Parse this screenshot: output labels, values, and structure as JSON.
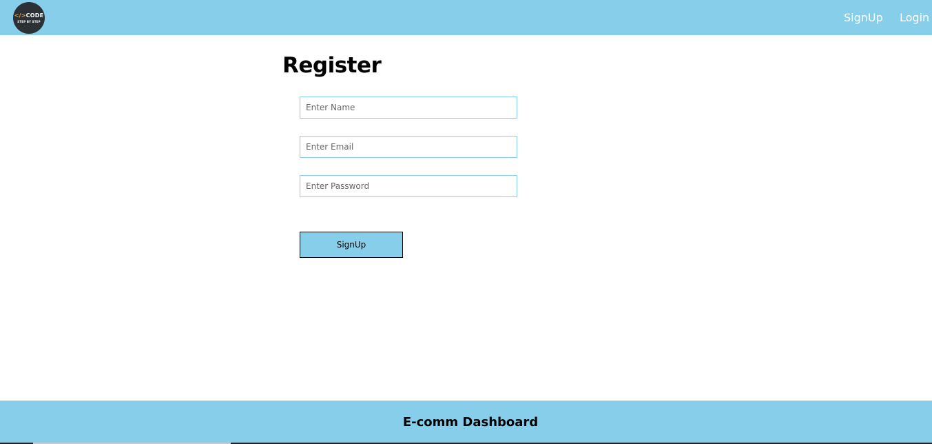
{
  "header": {
    "logo": {
      "line1_bracket": "</>",
      "line1_word": "CODE",
      "line2": "STEP BY STEP"
    },
    "nav": {
      "signup_label": "SignUp",
      "login_label": "Login"
    }
  },
  "main": {
    "title": "Register",
    "fields": {
      "name": {
        "placeholder": "Enter Name",
        "value": ""
      },
      "email": {
        "placeholder": "Enter Email",
        "value": ""
      },
      "password": {
        "placeholder": "Enter Password",
        "value": ""
      }
    },
    "submit_label": "SignUp"
  },
  "footer": {
    "title": "E-comm Dashboard"
  },
  "colors": {
    "accent": "#87ceeb",
    "logo_bg": "#2c3136",
    "logo_bracket": "#e9a13b",
    "text": "#000000",
    "nav_text": "#ffffff"
  }
}
